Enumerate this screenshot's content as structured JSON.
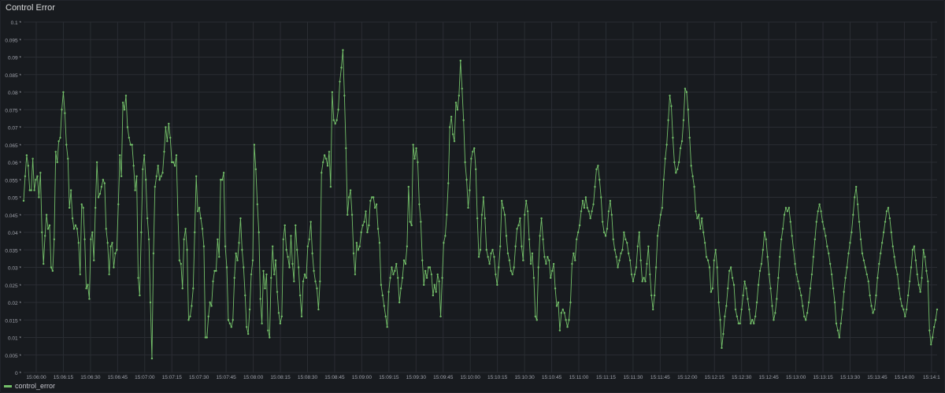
{
  "panel": {
    "title": "Control Error"
  },
  "legend": {
    "series_name": "control_error",
    "color": "#73bf69"
  },
  "colors": {
    "background": "#181b1f",
    "grid": "#2a2d33",
    "tick_text": "#9fa2ab",
    "series": "#73bf69"
  },
  "chart_data": {
    "type": "line",
    "title": "Control Error",
    "xlabel": "",
    "ylabel": "",
    "ylim": [
      0,
      0.1
    ],
    "y_ticks": [
      "0 *",
      "0.005 *",
      "0.01 *",
      "0.015 *",
      "0.02 *",
      "0.025 *",
      "0.03 *",
      "0.035 *",
      "0.04 *",
      "0.045 *",
      "0.05 *",
      "0.055 *",
      "0.06 *",
      "0.065 *",
      "0.07 *",
      "0.075 *",
      "0.08 *",
      "0.085 *",
      "0.09 *",
      "0.095 *",
      "0.1 *"
    ],
    "y_tick_values": [
      0,
      0.005,
      0.01,
      0.015,
      0.02,
      0.025,
      0.03,
      0.035,
      0.04,
      0.045,
      0.05,
      0.055,
      0.06,
      0.065,
      0.07,
      0.075,
      0.08,
      0.085,
      0.09,
      0.095,
      0.1
    ],
    "x_ticks": [
      "15:06:00",
      "15:06:15",
      "15:06:30",
      "15:06:45",
      "15:07:00",
      "15:07:15",
      "15:07:30",
      "15:07:45",
      "15:08:00",
      "15:08:15",
      "15:08:30",
      "15:08:45",
      "15:09:00",
      "15:09:15",
      "15:09:30",
      "15:09:45",
      "15:10:00",
      "15:10:15",
      "15:10:30",
      "15:10:45",
      "15:11:00",
      "15:11:15",
      "15:11:30",
      "15:11:45",
      "15:12:00",
      "15:12:15",
      "15:12:30",
      "15:12:45",
      "15:13:00",
      "15:13:15",
      "15:13:30",
      "15:13:45",
      "15:14:00",
      "15:14:1"
    ],
    "x_start": "15:05:54",
    "x_step_seconds": 1,
    "grid": true,
    "legend_position": "bottom-left",
    "series": [
      {
        "name": "control_error",
        "color": "#73bf69",
        "values": [
          0.049,
          0.056,
          0.062,
          0.059,
          0.052,
          0.052,
          0.061,
          0.052,
          0.055,
          0.056,
          0.05,
          0.057,
          0.04,
          0.031,
          0.039,
          0.045,
          0.041,
          0.042,
          0.03,
          0.029,
          0.038,
          0.063,
          0.06,
          0.066,
          0.067,
          0.075,
          0.08,
          0.074,
          0.065,
          0.061,
          0.047,
          0.052,
          0.044,
          0.041,
          0.042,
          0.041,
          0.037,
          0.028,
          0.048,
          0.047,
          0.038,
          0.024,
          0.025,
          0.021,
          0.038,
          0.04,
          0.032,
          0.047,
          0.06,
          0.05,
          0.051,
          0.053,
          0.055,
          0.054,
          0.041,
          0.037,
          0.028,
          0.036,
          0.037,
          0.03,
          0.034,
          0.035,
          0.048,
          0.062,
          0.056,
          0.077,
          0.075,
          0.079,
          0.07,
          0.067,
          0.065,
          0.065,
          0.059,
          0.052,
          0.056,
          0.027,
          0.022,
          0.04,
          0.058,
          0.062,
          0.055,
          0.044,
          0.038,
          0.02,
          0.004,
          0.034,
          0.053,
          0.056,
          0.059,
          0.055,
          0.056,
          0.057,
          0.063,
          0.07,
          0.066,
          0.071,
          0.067,
          0.06,
          0.06,
          0.059,
          0.062,
          0.045,
          0.032,
          0.031,
          0.024,
          0.038,
          0.041,
          0.035,
          0.015,
          0.016,
          0.019,
          0.024,
          0.04,
          0.056,
          0.046,
          0.047,
          0.044,
          0.041,
          0.036,
          0.01,
          0.01,
          0.016,
          0.02,
          0.019,
          0.026,
          0.029,
          0.029,
          0.038,
          0.033,
          0.055,
          0.055,
          0.057,
          0.036,
          0.03,
          0.015,
          0.014,
          0.013,
          0.015,
          0.027,
          0.034,
          0.032,
          0.037,
          0.044,
          0.035,
          0.03,
          0.022,
          0.013,
          0.011,
          0.018,
          0.028,
          0.032,
          0.065,
          0.058,
          0.048,
          0.04,
          0.021,
          0.014,
          0.029,
          0.024,
          0.028,
          0.012,
          0.01,
          0.027,
          0.036,
          0.028,
          0.032,
          0.023,
          0.017,
          0.014,
          0.016,
          0.038,
          0.042,
          0.035,
          0.033,
          0.03,
          0.039,
          0.031,
          0.026,
          0.042,
          0.035,
          0.03,
          0.022,
          0.016,
          0.026,
          0.028,
          0.027,
          0.036,
          0.038,
          0.043,
          0.034,
          0.029,
          0.026,
          0.024,
          0.018,
          0.026,
          0.057,
          0.06,
          0.062,
          0.061,
          0.059,
          0.063,
          0.053,
          0.08,
          0.072,
          0.071,
          0.072,
          0.075,
          0.083,
          0.087,
          0.092,
          0.079,
          0.064,
          0.045,
          0.05,
          0.052,
          0.045,
          0.034,
          0.028,
          0.037,
          0.035,
          0.036,
          0.04,
          0.042,
          0.043,
          0.046,
          0.04,
          0.042,
          0.049,
          0.05,
          0.05,
          0.047,
          0.048,
          0.041,
          0.037,
          0.025,
          0.022,
          0.019,
          0.016,
          0.013,
          0.023,
          0.027,
          0.03,
          0.028,
          0.029,
          0.031,
          0.027,
          0.02,
          0.024,
          0.027,
          0.032,
          0.031,
          0.036,
          0.053,
          0.043,
          0.042,
          0.065,
          0.061,
          0.064,
          0.06,
          0.048,
          0.043,
          0.032,
          0.025,
          0.029,
          0.027,
          0.03,
          0.03,
          0.028,
          0.022,
          0.025,
          0.023,
          0.028,
          0.026,
          0.016,
          0.027,
          0.037,
          0.039,
          0.045,
          0.054,
          0.07,
          0.073,
          0.068,
          0.066,
          0.077,
          0.075,
          0.079,
          0.089,
          0.081,
          0.072,
          0.06,
          0.055,
          0.047,
          0.052,
          0.061,
          0.063,
          0.064,
          0.058,
          0.044,
          0.033,
          0.035,
          0.045,
          0.05,
          0.044,
          0.035,
          0.033,
          0.031,
          0.034,
          0.035,
          0.033,
          0.028,
          0.025,
          0.03,
          0.036,
          0.049,
          0.047,
          0.045,
          0.039,
          0.034,
          0.032,
          0.029,
          0.028,
          0.03,
          0.036,
          0.041,
          0.042,
          0.044,
          0.036,
          0.032,
          0.045,
          0.049,
          0.046,
          0.038,
          0.031,
          0.034,
          0.027,
          0.016,
          0.015,
          0.03,
          0.039,
          0.044,
          0.038,
          0.033,
          0.031,
          0.033,
          0.032,
          0.027,
          0.029,
          0.031,
          0.024,
          0.019,
          0.02,
          0.012,
          0.017,
          0.018,
          0.017,
          0.015,
          0.013,
          0.015,
          0.02,
          0.031,
          0.034,
          0.032,
          0.038,
          0.04,
          0.042,
          0.046,
          0.049,
          0.047,
          0.05,
          0.047,
          0.046,
          0.044,
          0.046,
          0.048,
          0.053,
          0.058,
          0.059,
          0.055,
          0.05,
          0.043,
          0.04,
          0.039,
          0.041,
          0.046,
          0.049,
          0.045,
          0.038,
          0.035,
          0.033,
          0.03,
          0.032,
          0.034,
          0.035,
          0.04,
          0.038,
          0.037,
          0.034,
          0.032,
          0.028,
          0.026,
          0.028,
          0.03,
          0.036,
          0.04,
          0.032,
          0.026,
          0.027,
          0.026,
          0.031,
          0.036,
          0.028,
          0.022,
          0.018,
          0.022,
          0.03,
          0.039,
          0.042,
          0.045,
          0.047,
          0.055,
          0.061,
          0.065,
          0.072,
          0.079,
          0.076,
          0.067,
          0.06,
          0.057,
          0.058,
          0.06,
          0.064,
          0.066,
          0.072,
          0.081,
          0.08,
          0.075,
          0.067,
          0.059,
          0.056,
          0.053,
          0.046,
          0.044,
          0.045,
          0.041,
          0.044,
          0.04,
          0.037,
          0.033,
          0.032,
          0.03,
          0.023,
          0.024,
          0.032,
          0.035,
          0.03,
          0.02,
          0.015,
          0.007,
          0.011,
          0.016,
          0.019,
          0.024,
          0.029,
          0.03,
          0.027,
          0.025,
          0.018,
          0.016,
          0.014,
          0.014,
          0.018,
          0.022,
          0.026,
          0.024,
          0.021,
          0.018,
          0.014,
          0.015,
          0.014,
          0.016,
          0.02,
          0.025,
          0.029,
          0.031,
          0.035,
          0.04,
          0.038,
          0.033,
          0.028,
          0.024,
          0.019,
          0.015,
          0.017,
          0.021,
          0.027,
          0.033,
          0.038,
          0.041,
          0.045,
          0.047,
          0.046,
          0.047,
          0.043,
          0.039,
          0.035,
          0.031,
          0.028,
          0.026,
          0.024,
          0.022,
          0.019,
          0.016,
          0.015,
          0.017,
          0.02,
          0.024,
          0.028,
          0.033,
          0.038,
          0.043,
          0.046,
          0.048,
          0.046,
          0.043,
          0.041,
          0.039,
          0.036,
          0.034,
          0.031,
          0.028,
          0.024,
          0.02,
          0.014,
          0.012,
          0.01,
          0.014,
          0.018,
          0.023,
          0.027,
          0.03,
          0.034,
          0.037,
          0.04,
          0.045,
          0.05,
          0.053,
          0.048,
          0.043,
          0.038,
          0.034,
          0.032,
          0.03,
          0.028,
          0.026,
          0.022,
          0.019,
          0.017,
          0.018,
          0.022,
          0.027,
          0.031,
          0.034,
          0.037,
          0.04,
          0.043,
          0.046,
          0.047,
          0.044,
          0.04,
          0.036,
          0.033,
          0.03,
          0.028,
          0.024,
          0.021,
          0.019,
          0.018,
          0.016,
          0.018,
          0.022,
          0.026,
          0.03,
          0.035,
          0.036,
          0.032,
          0.028,
          0.025,
          0.023,
          0.027,
          0.035,
          0.033,
          0.029,
          0.026,
          0.012,
          0.008,
          0.01,
          0.013,
          0.015,
          0.018
        ]
      }
    ]
  }
}
